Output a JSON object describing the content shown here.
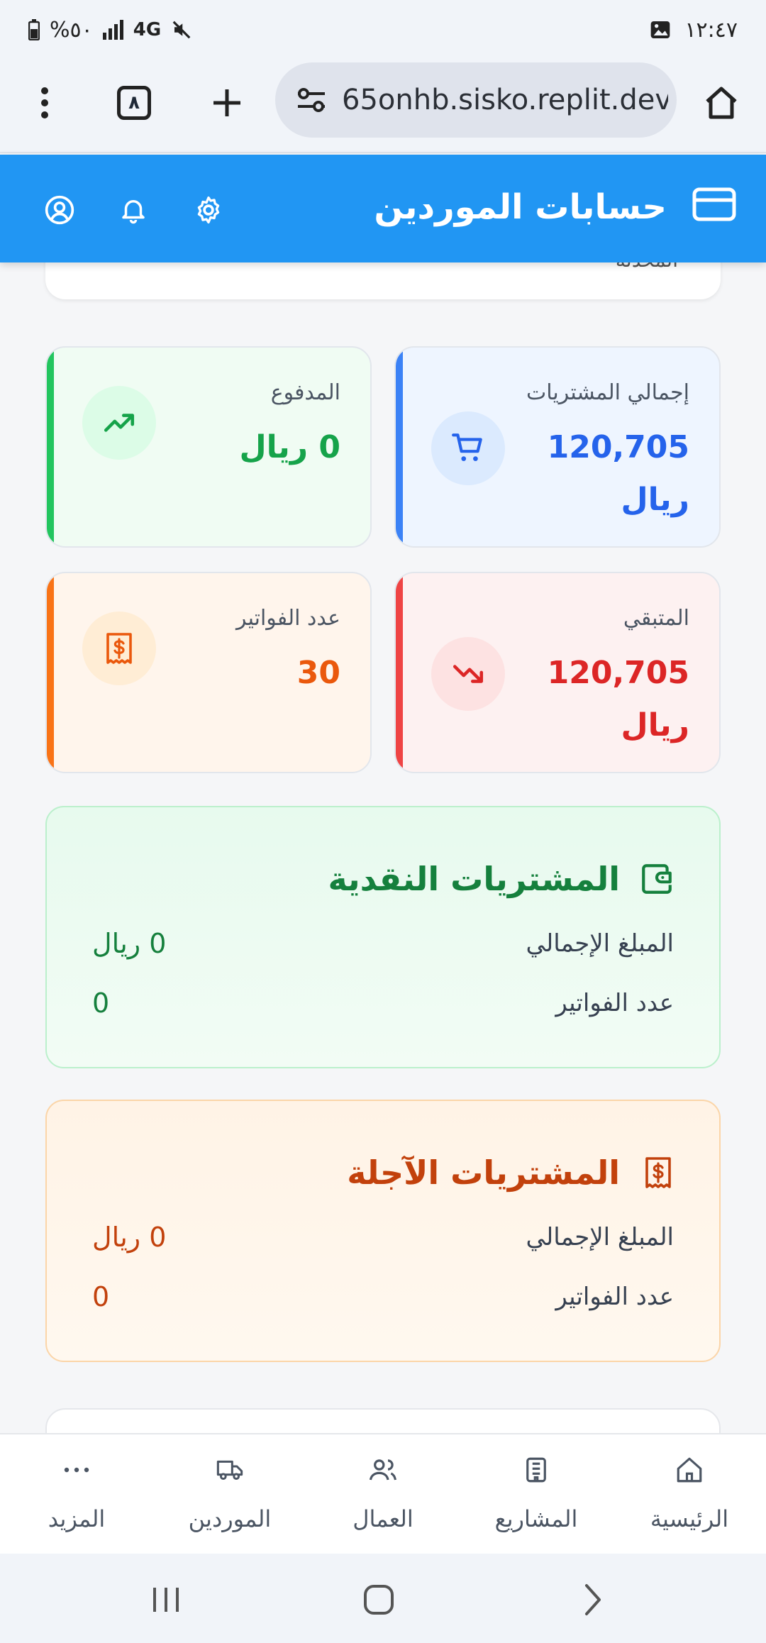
{
  "status_bar": {
    "time": "١٢:٤٧",
    "battery": "%٥٠",
    "network": "4G"
  },
  "browser": {
    "url": "65onhb.sisko.replit.dev",
    "tab_count": "٨"
  },
  "header": {
    "title": "حسابات الموردين"
  },
  "prev_card_text": "المحدثة",
  "stats": {
    "total_purchases": {
      "label": "إجمالي المشتريات",
      "value": "120,705 ريال",
      "color": "#2563eb",
      "bg": "#eff6ff"
    },
    "paid": {
      "label": "المدفوع",
      "value": "0 ريال",
      "color": "#16a34a",
      "bg": "#f0fdf4"
    },
    "remaining": {
      "label": "المتبقي",
      "value": "120,705 ريال",
      "color": "#dc2626",
      "bg": "#fef2f2"
    },
    "invoices_count": {
      "label": "عدد الفواتير",
      "value": "30",
      "color": "#ea580c",
      "bg": "#fff7ed"
    }
  },
  "cash_purchases": {
    "title": "المشتريات النقدية",
    "total_label": "المبلغ الإجمالي",
    "total_value": "0 ريال",
    "count_label": "عدد الفواتير",
    "count_value": "0"
  },
  "credit_purchases": {
    "title": "المشتريات الآجلة",
    "total_label": "المبلغ الإجمالي",
    "total_value": "0 ريال",
    "count_label": "عدد الفواتير",
    "count_value": "0"
  },
  "bottom_nav": {
    "items": [
      {
        "label": "الرئيسية",
        "icon": "home-icon"
      },
      {
        "label": "المشاريع",
        "icon": "building-icon"
      },
      {
        "label": "العمال",
        "icon": "users-icon"
      },
      {
        "label": "الموردين",
        "icon": "truck-icon"
      },
      {
        "label": "المزيد",
        "icon": "more-icon"
      }
    ]
  }
}
